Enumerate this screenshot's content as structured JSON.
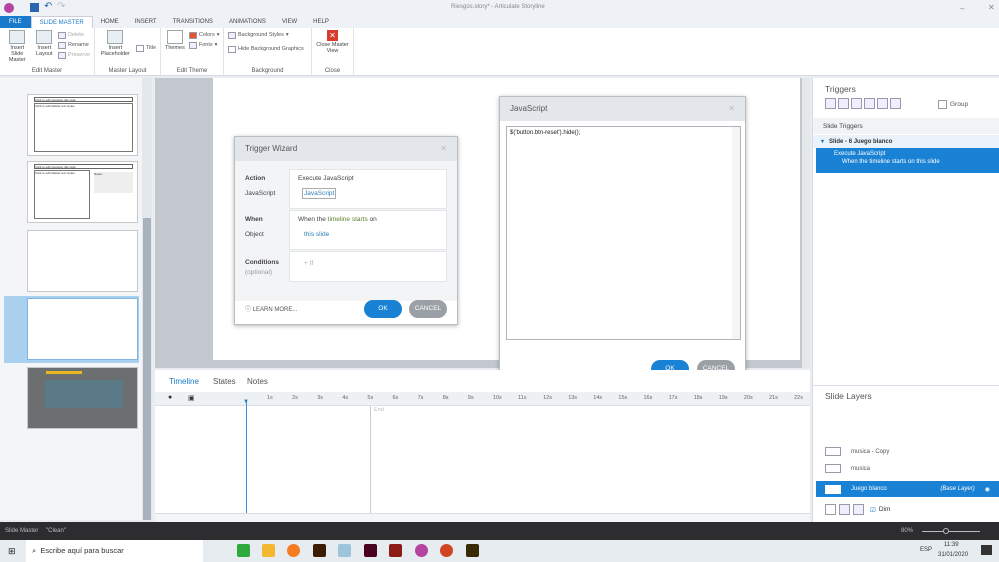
{
  "window": {
    "title": "Riesgos.story* - Articulate Storyline"
  },
  "tabs": [
    "FILE",
    "SLIDE MASTER",
    "HOME",
    "INSERT",
    "TRANSITIONS",
    "ANIMATIONS",
    "VIEW",
    "HELP"
  ],
  "ribbon": {
    "edit_master": {
      "label": "Edit Master",
      "insert_slide_master": "Insert Slide Master",
      "insert_layout": "Insert Layout",
      "delete": "Delete",
      "rename": "Rename",
      "preserve": "Preserve"
    },
    "master_layout": {
      "label": "Master Layout",
      "insert_placeholder": "Insert Placeholder",
      "title": "Title"
    },
    "edit_theme": {
      "label": "Edit Theme",
      "themes": "Themes",
      "colors": "Colors",
      "fonts": "Fonts"
    },
    "background": {
      "label": "Background",
      "styles": "Background Styles",
      "hide_graphics": "Hide Background Graphics"
    },
    "close": {
      "label": "Close",
      "close_master_view": "Close Master View"
    }
  },
  "thumbs": {
    "title_text": "Click to edit Question title style",
    "body_text": "Click to edit Master text styles",
    "notes": "Notes:"
  },
  "trigger_wizard": {
    "title": "Trigger Wizard",
    "action_label": "Action",
    "action_value": "Execute JavaScript",
    "js_label": "JavaScript",
    "js_value": "JavaScript",
    "when_label": "When",
    "when_prefix": "When the",
    "when_link": "timeline starts",
    "when_suffix": "on",
    "object_label": "Object",
    "object_value": "this slide",
    "conditions_label": "Conditions",
    "conditions_sub": "(optional)",
    "add_if": "+ If",
    "learn_more": "LEARN MORE...",
    "ok": "OK",
    "cancel": "CANCEL"
  },
  "js_dialog": {
    "title": "JavaScript",
    "code": "$('button.btn-reset').hide();",
    "ok": "OK",
    "cancel": "CANCEL"
  },
  "timeline": {
    "tabs": [
      "Timeline",
      "States",
      "Notes"
    ],
    "ticks": [
      "1s",
      "2s",
      "3s",
      "4s",
      "5s",
      "6s",
      "7s",
      "8s",
      "9s",
      "10s",
      "11s",
      "12s",
      "13s",
      "14s",
      "15s",
      "16s",
      "17s",
      "18s",
      "19s",
      "20s",
      "21s",
      "22s"
    ],
    "end_label": "End"
  },
  "triggers_panel": {
    "title": "Triggers",
    "group": "Group",
    "slide_triggers": "Slide Triggers",
    "slide_name": "Slide - 6 Juego blanco",
    "trigger_action": "Execute JavaScript",
    "trigger_when": "When the timeline starts on this slide"
  },
  "layers_panel": {
    "title": "Slide Layers",
    "layers": [
      "musica - Copy",
      "musica"
    ],
    "base_layer": "Juego blanco",
    "base_tag": "(Base Layer)",
    "dim": "Dim"
  },
  "status": {
    "mode": "Slide Master",
    "theme": "\"Clean\"",
    "zoom": "80%"
  },
  "taskbar": {
    "search_placeholder": "Escribe aquí para buscar",
    "lang": "ESP",
    "time": "11:39",
    "date": "31/01/2020"
  }
}
